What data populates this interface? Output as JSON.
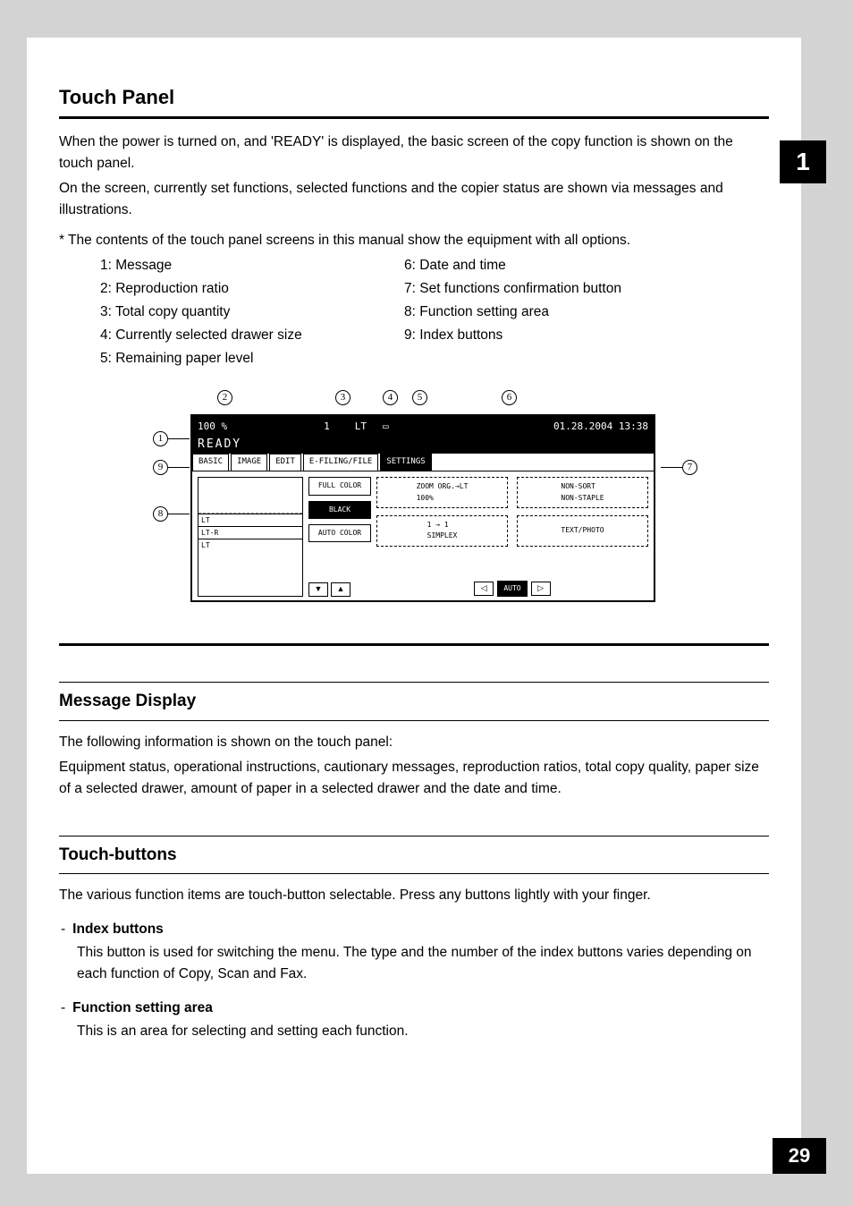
{
  "chapter": "1",
  "page_number": "29",
  "section_title": "Touch Panel",
  "intro_p1": "When the power is turned on, and 'READY' is displayed, the basic screen of the copy function is shown on the touch panel.",
  "intro_p2": "On the screen, currently set functions, selected functions and the copier status are shown via messages and illustrations.",
  "note": "*  The contents of the touch panel screens in this manual show the equipment with all options.",
  "legend_left": [
    "1: Message",
    "2: Reproduction ratio",
    "3: Total copy quantity",
    "4: Currently selected drawer size",
    "5: Remaining paper level"
  ],
  "legend_right": [
    "6: Date and time",
    "7: Set functions confirmation button",
    "8: Function setting area",
    "9: Index buttons"
  ],
  "callouts": {
    "c1": "1",
    "c2": "2",
    "c3": "3",
    "c4": "4",
    "c5": "5",
    "c6": "6",
    "c7": "7",
    "c8": "8",
    "c9": "9"
  },
  "panel": {
    "ratio": "100  %",
    "copy_qty": "1",
    "paper_size": "LT",
    "datetime": "01.28.2004 13:38",
    "ready": "READY",
    "tabs": {
      "basic": "BASIC",
      "image": "IMAGE",
      "edit": "EDIT",
      "efiling": "E-FILING/FILE",
      "settings": "SETTINGS"
    },
    "drawer": {
      "s1": "LT",
      "s2": "LT-R",
      "s3": "LT"
    },
    "color_btns": {
      "full": "FULL COLOR",
      "black": "BLACK",
      "auto": "AUTO COLOR"
    },
    "zoom": "ZOOM  ORG.→LT\n100%",
    "simplex": "1 → 1\nSIMPLEX",
    "sort": "NON-SORT\nNON-STAPLE",
    "textphoto": "TEXT/PHOTO",
    "density_auto": "AUTO",
    "arrows": {
      "down": "▼",
      "up": "▲",
      "left": "◁",
      "right": "▷"
    }
  },
  "sub1_title": "Message Display",
  "sub1_p1": "The following information is shown on the touch panel:",
  "sub1_p2": "Equipment status, operational instructions, cautionary messages, reproduction ratios, total copy quality, paper size of a selected drawer, amount of paper in a selected drawer and the date and time.",
  "sub2_title": "Touch-buttons",
  "sub2_p1": "The various function items are touch-button selectable. Press any buttons lightly with your finger.",
  "bullets": [
    {
      "term": "Index buttons",
      "desc": "This button is used for switching the menu. The type and the number of the index buttons varies depending on each function of Copy, Scan and Fax."
    },
    {
      "term": "Function setting area",
      "desc": "This is an area for selecting and setting each function."
    }
  ],
  "dash": "-"
}
